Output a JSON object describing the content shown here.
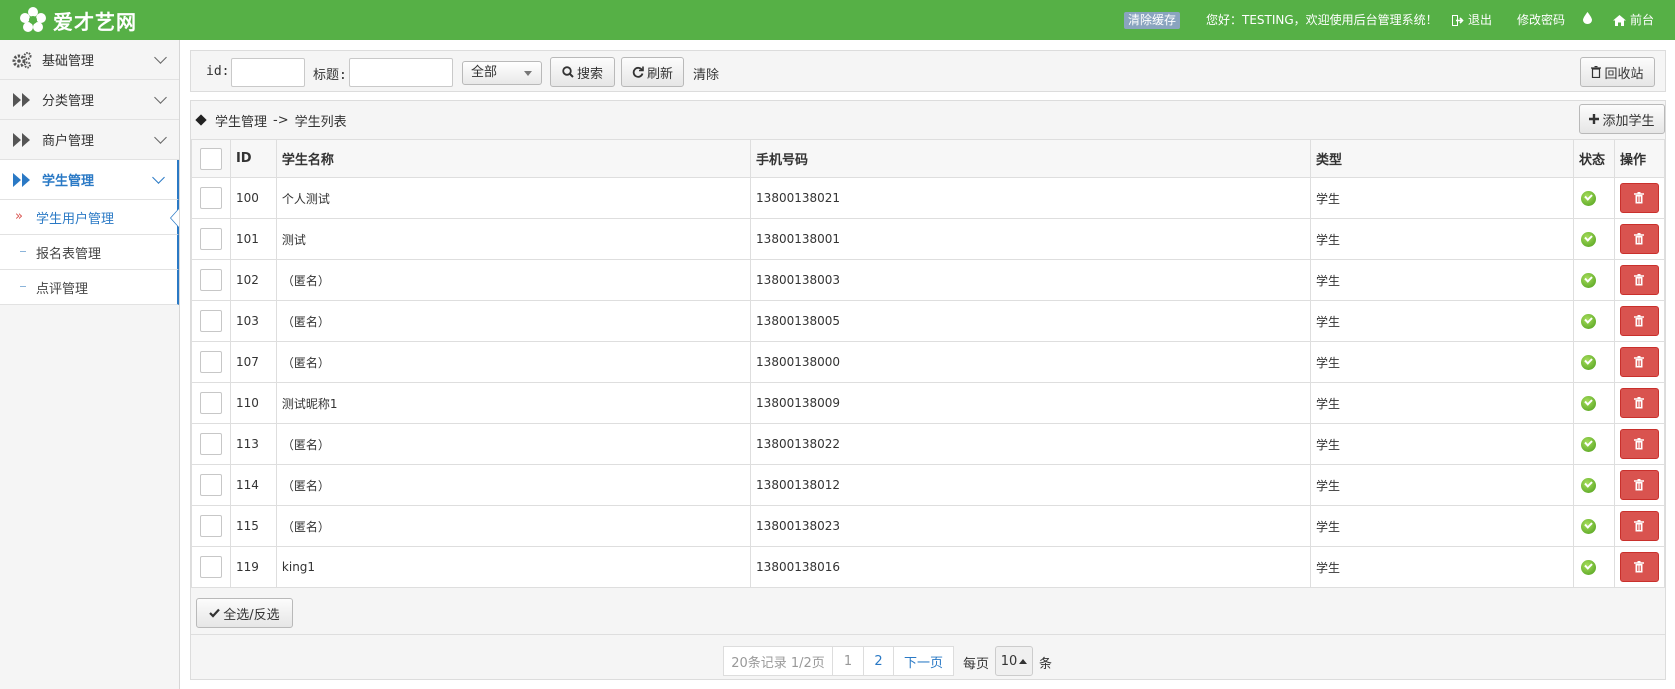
{
  "header": {
    "logo_text": "爱才艺网",
    "clear_cache": "清除缓存",
    "welcome": "您好：TESTING，欢迎使用后台管理系统！",
    "logout": "退出",
    "change_password": "修改密码",
    "frontend": "前台",
    "bg_color": "#56b046"
  },
  "sidebar": {
    "items": [
      {
        "label": "基础管理",
        "icon": "gears-icon"
      },
      {
        "label": "分类管理",
        "icon": "forward-icon"
      },
      {
        "label": "商户管理",
        "icon": "forward-icon"
      },
      {
        "label": "学生管理",
        "icon": "forward-icon",
        "active": true
      }
    ],
    "sub_items": [
      {
        "label": "学生用户管理",
        "active": true
      },
      {
        "label": "报名表管理"
      },
      {
        "label": "点评管理"
      }
    ],
    "accent": "#2a79c5"
  },
  "toolbar": {
    "id_label": "id:",
    "title_label": "标题:",
    "select_value": "全部",
    "search": "搜索",
    "refresh": "刷新",
    "clear": "清除",
    "recycle": "回收站"
  },
  "breadcrumb": {
    "section": "学生管理",
    "arrow": "->",
    "page": "学生列表",
    "add_button": "添加学生"
  },
  "table": {
    "headers": {
      "id": "ID",
      "name": "学生名称",
      "phone": "手机号码",
      "type": "类型",
      "status": "状态",
      "actions": "操作"
    },
    "rows": [
      {
        "id": "100",
        "name": "个人测试",
        "phone": "13800138021",
        "type": "学生"
      },
      {
        "id": "101",
        "name": "测试",
        "phone": "13800138001",
        "type": "学生"
      },
      {
        "id": "102",
        "name": "（匿名）",
        "phone": "13800138003",
        "type": "学生"
      },
      {
        "id": "103",
        "name": "（匿名）",
        "phone": "13800138005",
        "type": "学生"
      },
      {
        "id": "107",
        "name": "（匿名）",
        "phone": "13800138000",
        "type": "学生"
      },
      {
        "id": "110",
        "name": "测试昵称1",
        "phone": "13800138009",
        "type": "学生"
      },
      {
        "id": "113",
        "name": "（匿名）",
        "phone": "13800138022",
        "type": "学生"
      },
      {
        "id": "114",
        "name": "（匿名）",
        "phone": "13800138012",
        "type": "学生"
      },
      {
        "id": "115",
        "name": "（匿名）",
        "phone": "13800138023",
        "type": "学生"
      },
      {
        "id": "119",
        "name": "king1",
        "phone": "13800138016",
        "type": "学生"
      }
    ],
    "delete_color": "#d9534f",
    "status_color": "#4e9e1c"
  },
  "footer": {
    "select_all": "全选/反选"
  },
  "pagination": {
    "summary": "20条记录 1/2页",
    "pages": [
      "1",
      "2"
    ],
    "next": "下一页",
    "per_page_label": "每页",
    "per_page_value": "10",
    "per_page_unit": "条"
  }
}
